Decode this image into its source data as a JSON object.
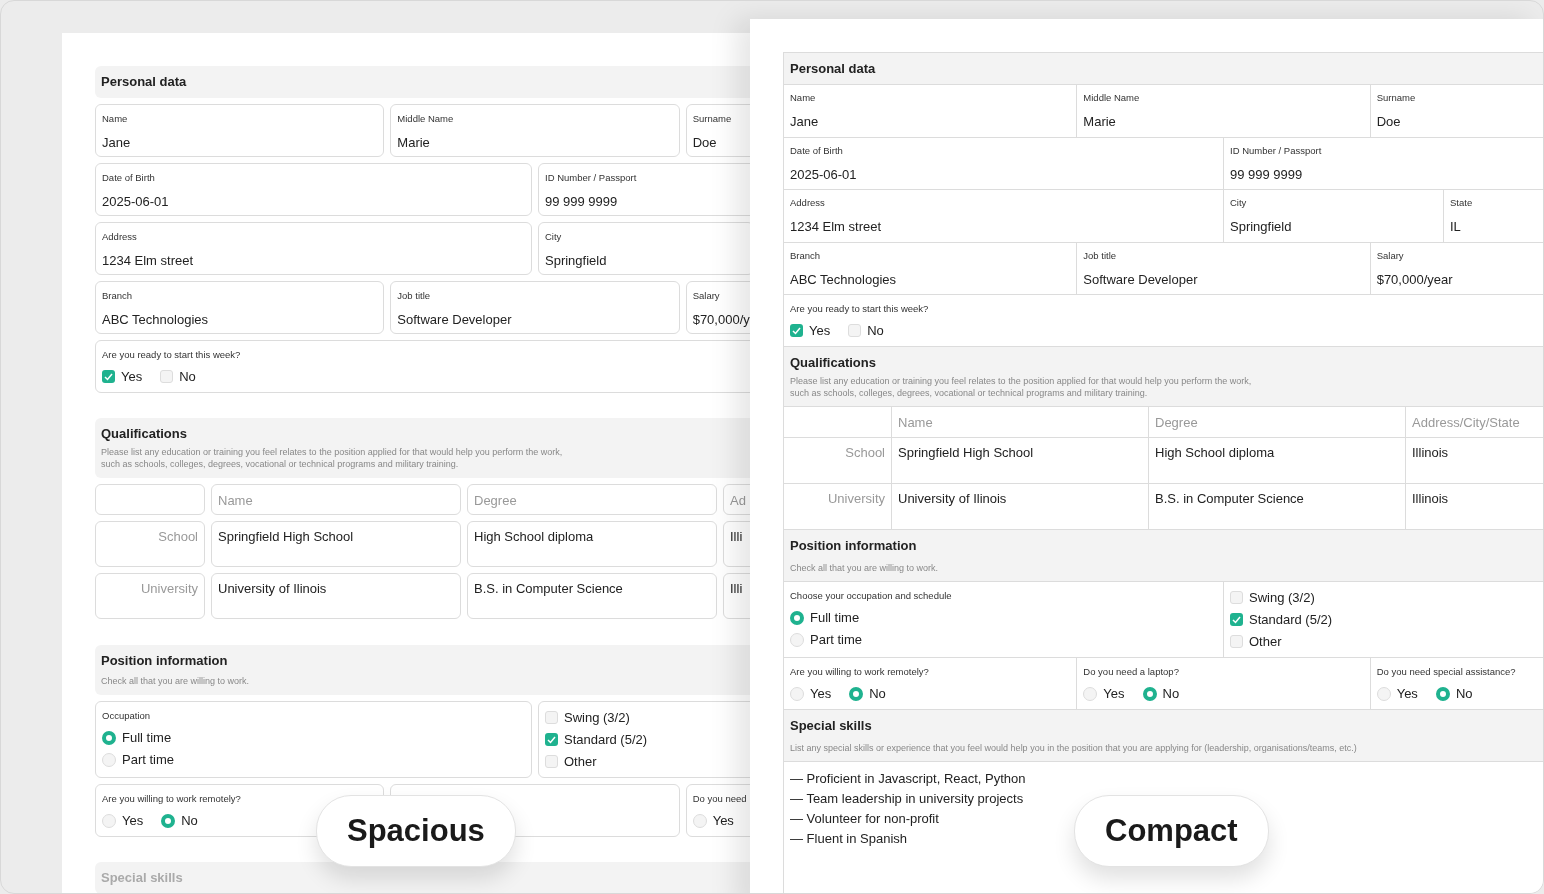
{
  "views": [
    {
      "kind": "spacious",
      "badge": "Spacious",
      "personal": {
        "title": "Personal data",
        "rows": [
          [
            {
              "label": "Name",
              "value": "Jane"
            },
            {
              "label": "Middle Name",
              "value": "Marie"
            },
            {
              "label": "Surname",
              "value": "Doe"
            }
          ],
          [
            {
              "label": "Date of Birth",
              "value": "2025-06-01"
            },
            {
              "label": "ID Number / Passport",
              "value": "99 999 9999"
            }
          ],
          [
            {
              "label": "Address",
              "value": "1234 Elm street"
            },
            {
              "label": "City",
              "value": "Springfield"
            }
          ],
          [
            {
              "label": "Branch",
              "value": "ABC Technologies"
            },
            {
              "label": "Job title",
              "value": "Software Developer"
            },
            {
              "label": "Salary",
              "value": "$70,000/y"
            }
          ]
        ],
        "ready": {
          "label": "Are you ready to start this week?",
          "options": [
            {
              "label": "Yes",
              "checked": true
            },
            {
              "label": "No",
              "checked": false
            }
          ]
        }
      },
      "qualifications": {
        "title": "Qualifications",
        "description": [
          "Please list any education or training you feel relates to the position applied for that would help you perform the work,",
          "such as schools, colleges, degrees, vocational or technical programs and military training."
        ],
        "columns": [
          "Name",
          "Degree",
          "Ad"
        ],
        "rows": [
          {
            "type": "School",
            "cells": [
              "Springfield High School",
              "High School diploma",
              "Illi"
            ]
          },
          {
            "type": "University",
            "cells": [
              "University of Ilinois",
              "B.S. in Computer Science",
              "Illi"
            ]
          }
        ]
      },
      "position": {
        "title": "Position information",
        "description": "Check all that you are willing to work.",
        "occupation": {
          "label": "Occupation",
          "options": [
            {
              "label": "Full time",
              "selected": true
            },
            {
              "label": "Part time",
              "selected": false
            }
          ]
        },
        "schedule": [
          {
            "label": "Swing (3/2)",
            "checked": false
          },
          {
            "label": "Standard (5/2)",
            "checked": true
          },
          {
            "label": "Other",
            "checked": false
          }
        ],
        "questions": [
          {
            "kind": "shown",
            "label": "Are you willing to work remotely?",
            "options": [
              {
                "label": "Yes",
                "selected": false
              },
              {
                "label": "No",
                "selected": true
              }
            ]
          },
          {
            "kind": "covered"
          },
          {
            "kind": "shown",
            "label": "Do you need",
            "options": [
              {
                "label": "Yes",
                "selected": false
              }
            ]
          }
        ]
      },
      "skills": {
        "title": "Special skills"
      }
    },
    {
      "kind": "compact",
      "badge": "Compact",
      "personal": {
        "title": "Personal data",
        "rows": [
          [
            {
              "label": "Name",
              "value": "Jane"
            },
            {
              "label": "Middle Name",
              "value": "Marie"
            },
            {
              "label": "Surname",
              "value": "Doe"
            }
          ],
          [
            {
              "label": "Date of Birth",
              "value": "2025-06-01"
            },
            {
              "label": "ID Number / Passport",
              "value": "99 999 9999"
            }
          ],
          [
            {
              "label": "Address",
              "value": "1234 Elm street"
            },
            {
              "label": "City",
              "value": "Springfield"
            },
            {
              "label": "State",
              "value": "IL"
            }
          ],
          [
            {
              "label": "Branch",
              "value": "ABC Technologies"
            },
            {
              "label": "Job title",
              "value": "Software Developer"
            },
            {
              "label": "Salary",
              "value": "$70,000/year"
            }
          ]
        ],
        "ready": {
          "label": "Are you ready to start this week?",
          "options": [
            {
              "label": "Yes",
              "checked": true
            },
            {
              "label": "No",
              "checked": false
            }
          ]
        }
      },
      "qualifications": {
        "title": "Qualifications",
        "description": [
          "Please list any education or training you feel relates to the position applied for that would help you perform the work,",
          "such as schools, colleges, degrees, vocational or technical programs and military training."
        ],
        "columns": [
          "Name",
          "Degree",
          "Address/City/State"
        ],
        "rows": [
          {
            "type": "School",
            "cells": [
              "Springfield High School",
              "High School diploma",
              "Illinois"
            ]
          },
          {
            "type": "University",
            "cells": [
              "University of Ilinois",
              "B.S. in Computer Science",
              "Illinois"
            ]
          }
        ]
      },
      "position": {
        "title": "Position information",
        "description": "Check all that you are willing to work.",
        "occupation": {
          "label": "Choose your occupation and schedule",
          "options": [
            {
              "label": "Full time",
              "selected": true
            },
            {
              "label": "Part time",
              "selected": false
            }
          ]
        },
        "schedule": [
          {
            "label": "Swing (3/2)",
            "checked": false
          },
          {
            "label": "Standard (5/2)",
            "checked": true
          },
          {
            "label": "Other",
            "checked": false
          }
        ],
        "questions": [
          {
            "kind": "shown",
            "label": "Are you willing to work remotely?",
            "options": [
              {
                "label": "Yes",
                "selected": false
              },
              {
                "label": "No",
                "selected": true
              }
            ]
          },
          {
            "kind": "shown",
            "label": "Do you need a laptop?",
            "options": [
              {
                "label": "Yes",
                "selected": false
              },
              {
                "label": "No",
                "selected": true
              }
            ]
          },
          {
            "kind": "shown",
            "label": "Do you need special assistance?",
            "options": [
              {
                "label": "Yes",
                "selected": false
              },
              {
                "label": "No",
                "selected": true
              }
            ]
          }
        ]
      },
      "skills": {
        "title": "Special skills",
        "description": "List any special skills or experience that you feel would help you in the position that you are applying for (leadership, organisations/teams, etc.)",
        "items": [
          "— Proficient in Javascript, React, Python",
          "— Team leadership in university projects",
          "— Volunteer for non-profit",
          "— Fluent in Spanish"
        ]
      }
    }
  ]
}
